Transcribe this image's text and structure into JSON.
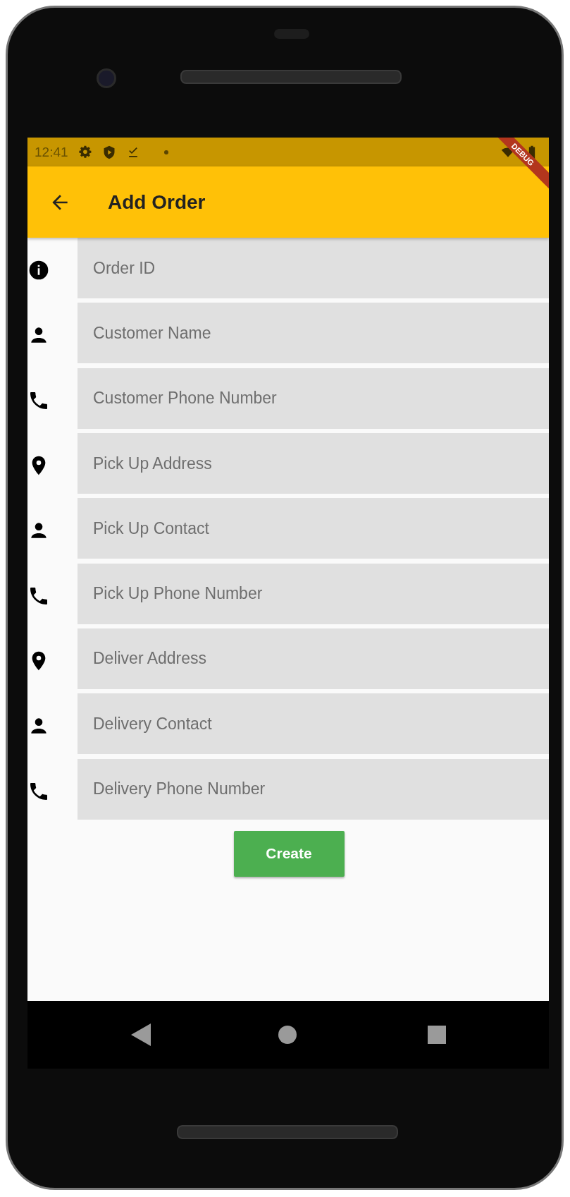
{
  "status_bar": {
    "time": "12:41",
    "debug_banner": "DEBUG"
  },
  "app_bar": {
    "title": "Add Order"
  },
  "fields": [
    {
      "kind": "info",
      "placeholder": "Order ID"
    },
    {
      "kind": "person",
      "placeholder": "Customer Name"
    },
    {
      "kind": "phone",
      "placeholder": "Customer Phone Number"
    },
    {
      "kind": "address",
      "placeholder": "Pick Up Address"
    },
    {
      "kind": "person",
      "placeholder": "Pick Up Contact"
    },
    {
      "kind": "phone",
      "placeholder": "Pick Up Phone Number"
    },
    {
      "kind": "address",
      "placeholder": "Deliver Address"
    },
    {
      "kind": "person",
      "placeholder": "Delivery Contact"
    },
    {
      "kind": "phone",
      "placeholder": "Delivery Phone Number"
    }
  ],
  "create_button": {
    "label": "Create"
  }
}
